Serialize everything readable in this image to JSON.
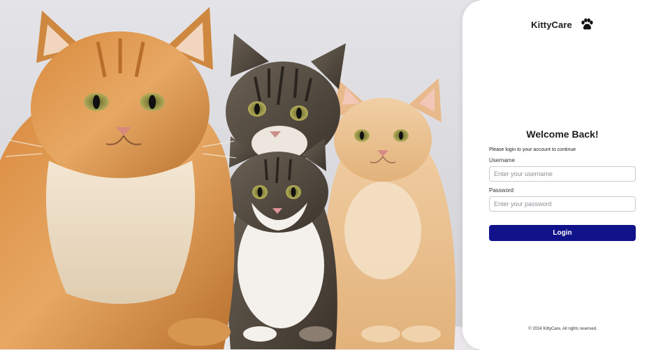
{
  "brand": {
    "name": "KittyCare",
    "icon": "paw-icon"
  },
  "login": {
    "title": "Welcome Back!",
    "subtitle": "Please login to your account to continue",
    "username_label": "Username",
    "username_placeholder": "Enter your username",
    "username_value": "",
    "password_label": "Password",
    "password_placeholder": "Enter your password",
    "password_value": "",
    "button_label": "Login"
  },
  "footer": {
    "text": "© 2024 KittyCare. All rights reserved."
  },
  "colors": {
    "primary": "#11138a",
    "panel_bg": "#ffffff",
    "text": "#1d1d1d"
  },
  "hero": {
    "description_icon": "cats-photo"
  }
}
